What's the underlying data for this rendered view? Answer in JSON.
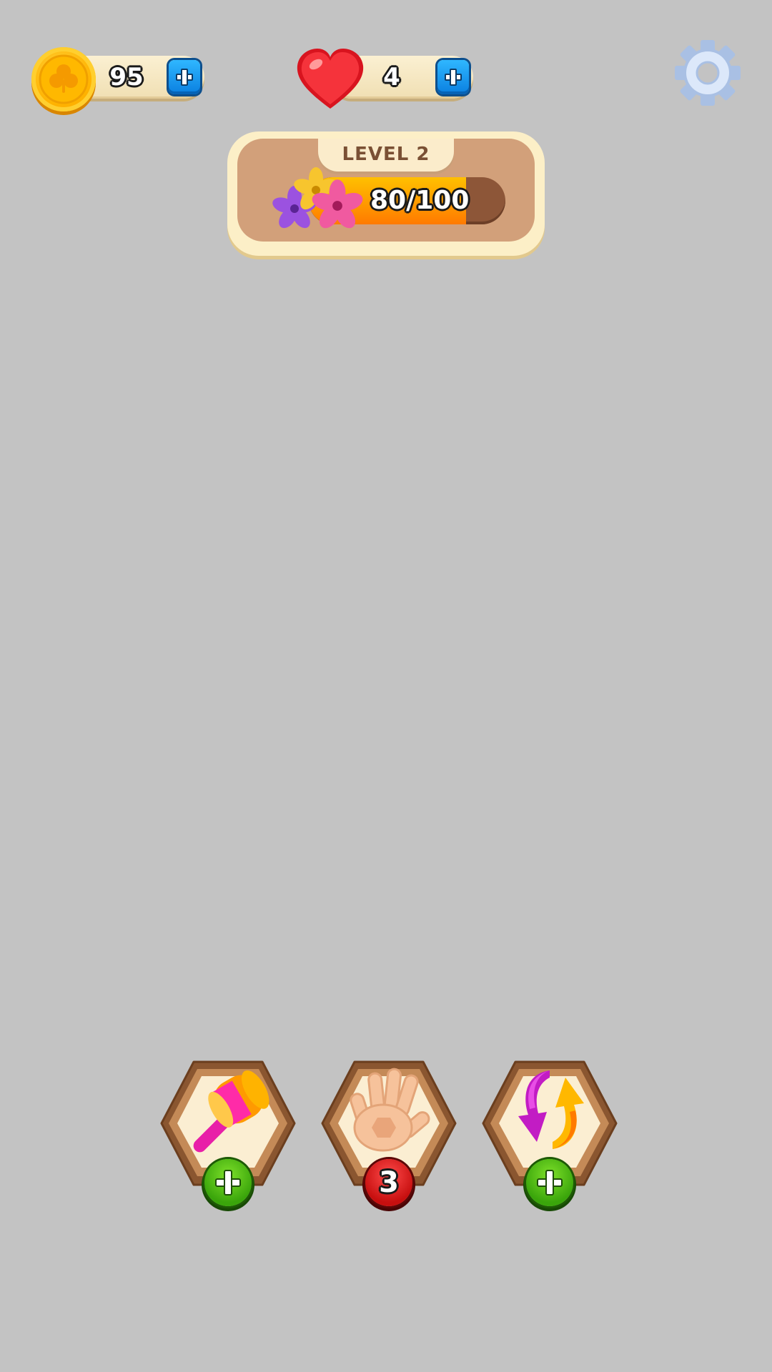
{
  "hud": {
    "coins": {
      "value": "95",
      "icon": "clover-coin-icon"
    },
    "lives": {
      "value": "4",
      "icon": "heart-icon"
    },
    "settings_icon": "gear-icon"
  },
  "level": {
    "label": "LEVEL 2",
    "progress_text": "80/100",
    "progress_fraction": 0.8
  },
  "boosters": [
    {
      "name": "hammer",
      "icon": "hammer-icon",
      "badge": "add"
    },
    {
      "name": "hand",
      "icon": "hand-icon",
      "badge": "count",
      "count": "3"
    },
    {
      "name": "shuffle",
      "icon": "shuffle-arrows-icon",
      "badge": "add"
    }
  ],
  "colors": {
    "background": "#c3c3c3",
    "accent_blue": "#0a7fe0",
    "badge_green": "#3aa50b",
    "badge_red": "#c70f0f",
    "progress_orange": "#ff9a00"
  }
}
